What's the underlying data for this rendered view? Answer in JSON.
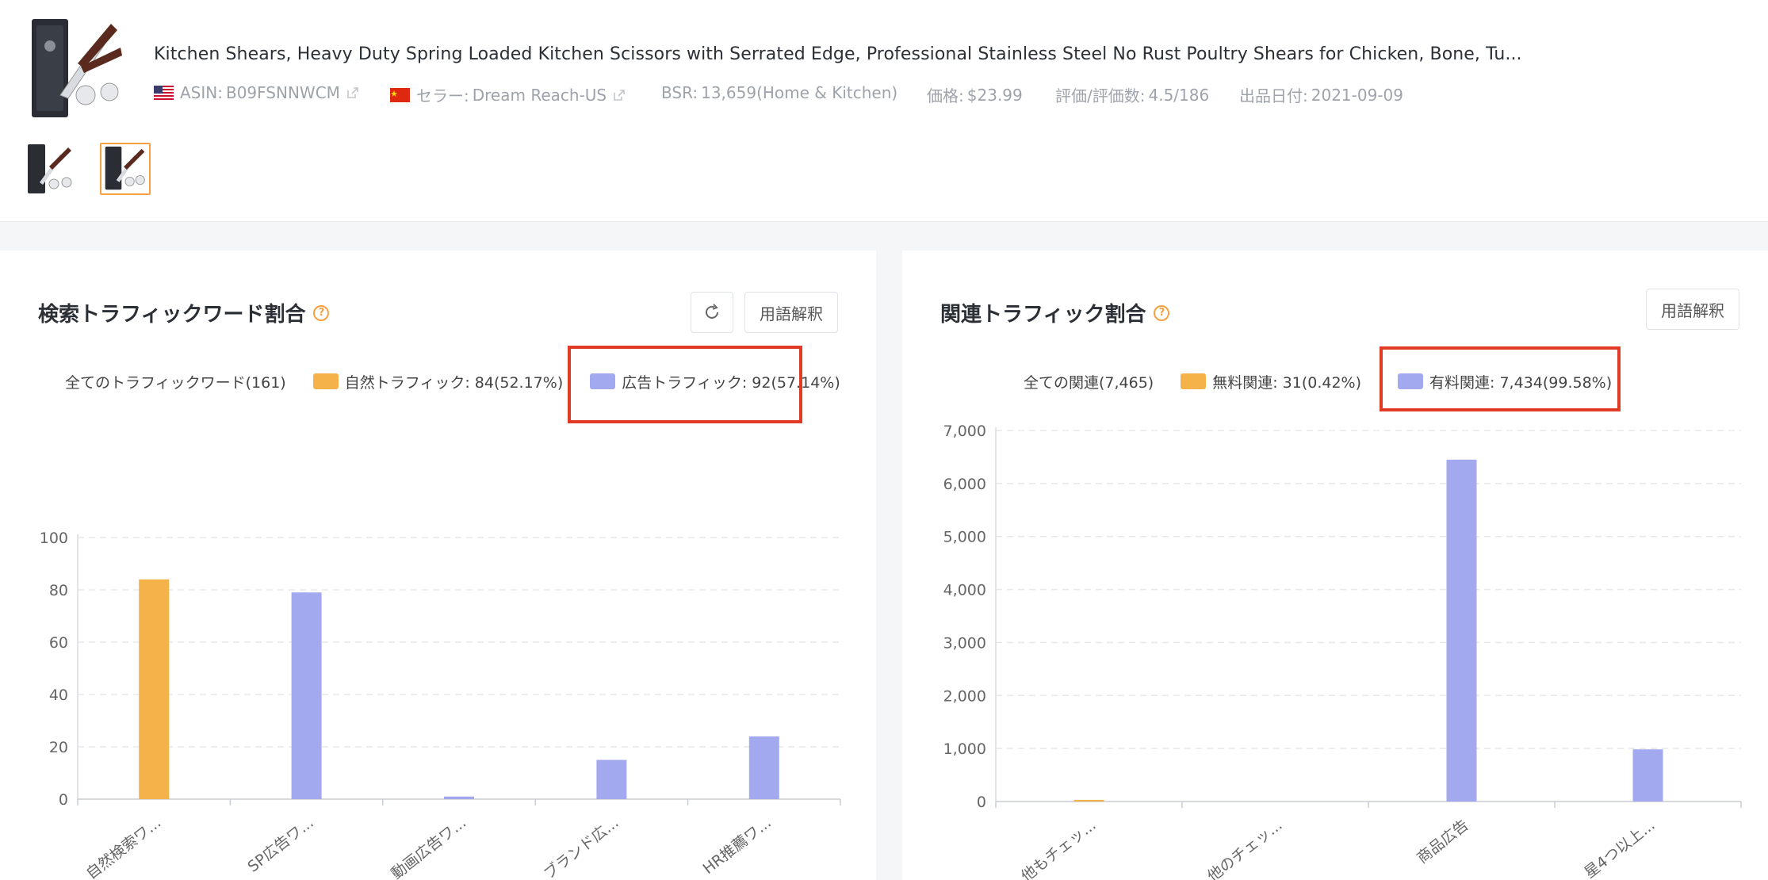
{
  "product": {
    "title": "Kitchen Shears, Heavy Duty Spring Loaded Kitchen Scissors with Serrated Edge, Professional Stainless Steel No Rust Poultry Shears for Chicken, Bone, Tu...",
    "asin_label": "ASIN:",
    "asin": "B09FSNNWCM",
    "seller_label": "セラー:",
    "seller": "Dream Reach-US",
    "bsr_label": "BSR:",
    "bsr": "13,659(Home & Kitchen)",
    "price_label": "価格:",
    "price": "$23.99",
    "rating_label": "評価/評価数:",
    "rating": "4.5/186",
    "date_label": "出品日付:",
    "date": "2021-09-09"
  },
  "colors": {
    "organic": "#f5b24b",
    "paid": "#a3a9ee",
    "highlight": "#e13a26",
    "accent": "#f5a142"
  },
  "left_panel": {
    "title": "検索トラフィックワード割合",
    "refresh_icon": "refresh-icon",
    "glossary_button": "用語解釈",
    "legend_all": "全てのトラフィックワード(161)",
    "legend_organic": "自然トラフィック: 84(52.17%)",
    "legend_paid": "広告トラフィック: 92(57.14%)"
  },
  "right_panel": {
    "title": "関連トラフィック割合",
    "glossary_button": "用語解釈",
    "legend_all": "全ての関連(7,465)",
    "legend_free": "無料関連: 31(0.42%)",
    "legend_paid": "有料関連: 7,434(99.58%)"
  },
  "chart_data": [
    {
      "type": "bar",
      "categories": [
        "自然検索ワ...",
        "SP広告ワ...",
        "動画広告ワ...",
        "ブランド広...",
        "HR推薦ワ..."
      ],
      "values": [
        84,
        79,
        1,
        15,
        24
      ],
      "series_colors": [
        "organic",
        "paid",
        "paid",
        "paid",
        "paid"
      ],
      "ylim": [
        0,
        100
      ],
      "yticks": [
        0,
        20,
        40,
        60,
        80,
        100
      ],
      "ytick_labels": [
        "0",
        "20",
        "40",
        "60",
        "80",
        "100"
      ],
      "grid": true,
      "title": "",
      "xlabel": "",
      "ylabel": ""
    },
    {
      "type": "bar",
      "categories": [
        "他もチェッ...",
        "他のチェッ...",
        "商品広告",
        "星4つ以上..."
      ],
      "values": [
        31,
        0,
        6450,
        984
      ],
      "series_colors": [
        "organic",
        "organic",
        "paid",
        "paid"
      ],
      "ylim": [
        0,
        7000
      ],
      "yticks": [
        0,
        1000,
        2000,
        3000,
        4000,
        5000,
        6000,
        7000
      ],
      "ytick_labels": [
        "0",
        "1,000",
        "2,000",
        "3,000",
        "4,000",
        "5,000",
        "6,000",
        "7,000"
      ],
      "grid": true,
      "title": "",
      "xlabel": "",
      "ylabel": ""
    }
  ]
}
